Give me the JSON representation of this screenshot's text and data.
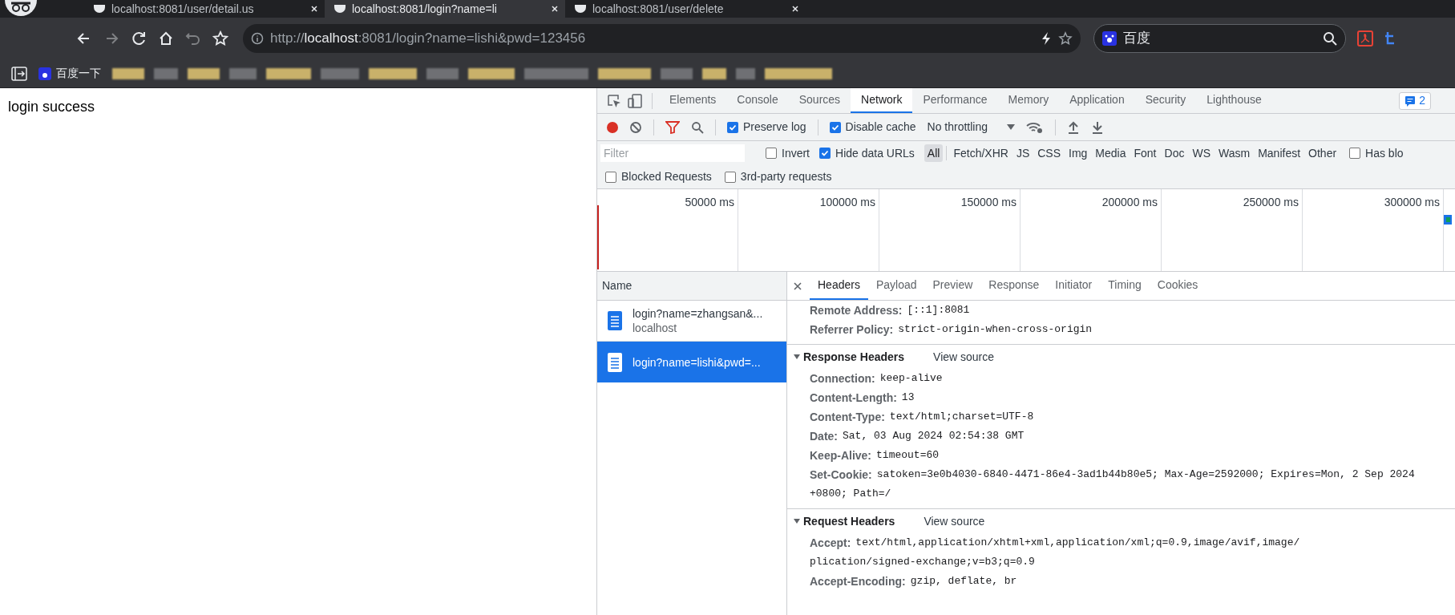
{
  "browser": {
    "tabs": [
      {
        "title": "localhost:8081/user/detail.us",
        "selected": false
      },
      {
        "title": "localhost:8081/login?name=li",
        "selected": true
      },
      {
        "title": "localhost:8081/user/delete",
        "selected": false
      }
    ],
    "address": "http://**localhost**:8081/login?name=lishi&pwd=123456",
    "search": {
      "value": "百度"
    },
    "bookmarks": [
      {
        "label": "百度一下"
      }
    ]
  },
  "page": {
    "text": "login success"
  },
  "devtools": {
    "tabs": [
      {
        "label": "Elements",
        "selected": false
      },
      {
        "label": "Console",
        "selected": false
      },
      {
        "label": "Sources",
        "selected": false
      },
      {
        "label": "Network",
        "selected": true
      },
      {
        "label": "Performance",
        "selected": false
      },
      {
        "label": "Memory",
        "selected": false
      },
      {
        "label": "Application",
        "selected": false
      },
      {
        "label": "Security",
        "selected": false
      },
      {
        "label": "Lighthouse",
        "selected": false
      }
    ],
    "issues_badge": "2",
    "toolbar": {
      "recording": true,
      "preserve_log": {
        "label": "Preserve log",
        "checked": true
      },
      "disable_cache": {
        "label": "Disable cache",
        "checked": true
      },
      "throttling": "No throttling"
    },
    "filter": {
      "placeholder": "Filter",
      "invert": {
        "label": "Invert",
        "checked": false
      },
      "hide_data_urls": {
        "label": "Hide data URLs",
        "checked": true
      },
      "types": [
        {
          "label": "All",
          "selected": true
        },
        {
          "label": "Fetch/XHR",
          "selected": false
        },
        {
          "label": "JS",
          "selected": false
        },
        {
          "label": "CSS",
          "selected": false
        },
        {
          "label": "Img",
          "selected": false
        },
        {
          "label": "Media",
          "selected": false
        },
        {
          "label": "Font",
          "selected": false
        },
        {
          "label": "Doc",
          "selected": false
        },
        {
          "label": "WS",
          "selected": false
        },
        {
          "label": "Wasm",
          "selected": false
        },
        {
          "label": "Manifest",
          "selected": false
        },
        {
          "label": "Other",
          "selected": false
        }
      ],
      "has_blocked": {
        "label": "Has blo",
        "checked": false
      },
      "blocked_requests": {
        "label": "Blocked Requests",
        "checked": false
      },
      "third_party": {
        "label": "3rd-party requests",
        "checked": false
      }
    },
    "timeline": {
      "ticks": [
        "50000 ms",
        "100000 ms",
        "150000 ms",
        "200000 ms",
        "250000 ms",
        "300000 ms"
      ]
    },
    "name_header": "Name",
    "requests": [
      {
        "name": "login?name=zhangsan&...",
        "host": "localhost",
        "selected": false
      },
      {
        "name": "login?name=lishi&pwd=...",
        "selected": true
      }
    ],
    "detail_tabs": [
      {
        "label": "Headers",
        "selected": true
      },
      {
        "label": "Payload",
        "selected": false
      },
      {
        "label": "Preview",
        "selected": false
      },
      {
        "label": "Response",
        "selected": false
      },
      {
        "label": "Initiator",
        "selected": false
      },
      {
        "label": "Timing",
        "selected": false
      },
      {
        "label": "Cookies",
        "selected": false
      }
    ],
    "sections": [
      {
        "rows": [
          {
            "name": "Remote Address:",
            "value": "[::1]:8081"
          },
          {
            "name": "Referrer Policy:",
            "value": "strict-origin-when-cross-origin"
          }
        ]
      },
      {
        "title": "Response Headers",
        "view_source": "View source",
        "expanded": true,
        "rows": [
          {
            "name": "Connection:",
            "value": "keep-alive"
          },
          {
            "name": "Content-Length:",
            "value": "13"
          },
          {
            "name": "Content-Type:",
            "value": "text/html;charset=UTF-8"
          },
          {
            "name": "Date:",
            "value": "Sat, 03 Aug 2024 02:54:38 GMT"
          },
          {
            "name": "Keep-Alive:",
            "value": "timeout=60"
          },
          {
            "name": "Set-Cookie:",
            "value": "satoken=3e0b4030-6840-4471-86e4-3ad1b44b80e5; Max-Age=2592000; Expires=Mon, 2 Sep 2024",
            "continuation": "+0800; Path=/"
          }
        ]
      },
      {
        "title": "Request Headers",
        "view_source": "View source",
        "expanded": true,
        "rows": [
          {
            "name": "Accept:",
            "value": "text/html,application/xhtml+xml,application/xml;q=0.9,image/avif,image/",
            "continuation": "plication/signed-exchange;v=b3;q=0.9"
          },
          {
            "name": "Accept-Encoding:",
            "value": "gzip, deflate, br"
          }
        ]
      }
    ]
  }
}
